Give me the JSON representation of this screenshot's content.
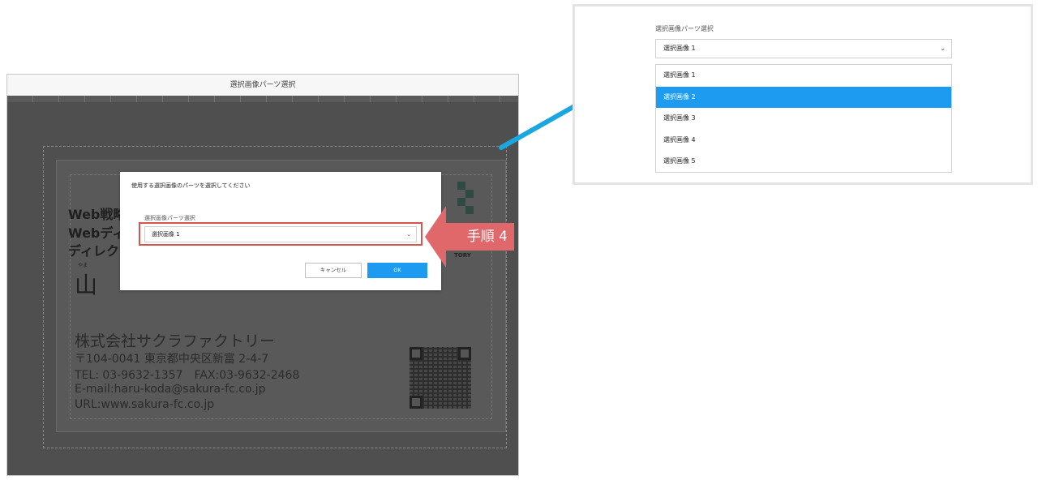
{
  "editor": {
    "title": "選択画像パーツ選択",
    "card": {
      "title_line1": "Web戦略",
      "title_line2": "Webディ",
      "title_line3": "ディレク",
      "ruby": "やま",
      "name": "山",
      "company": "株式会社サクラファクトリー",
      "address": "〒104-0041 東京都中央区新富 2-4-7",
      "tel": "TEL: 03-9632-1357　FAX:03-9632-2468",
      "email": "E-mail:haru-koda@sakura-fc.co.jp",
      "url": "URL:www.sakura-fc.co.jp",
      "logo_text": "TORY"
    }
  },
  "modal": {
    "prompt": "使用する選択画像のパーツを選択してください",
    "label": "選択画像パーツ選択",
    "selected_value": "選択画像 1",
    "cancel_label": "キャンセル",
    "ok_label": "OK"
  },
  "step": {
    "label": "手順 4",
    "color": "#e0676a"
  },
  "zoom_panel": {
    "label": "選択画像パーツ選択",
    "selected_value": "選択画像 1",
    "options": [
      "選択画像 1",
      "選択画像 2",
      "選択画像 3",
      "選択画像 4",
      "選択画像 5"
    ],
    "highlighted_option": "選択画像 2"
  },
  "colors": {
    "accent": "#1c9bf0",
    "connector": "#1aa6e0",
    "highlight_border": "#d9534f"
  }
}
